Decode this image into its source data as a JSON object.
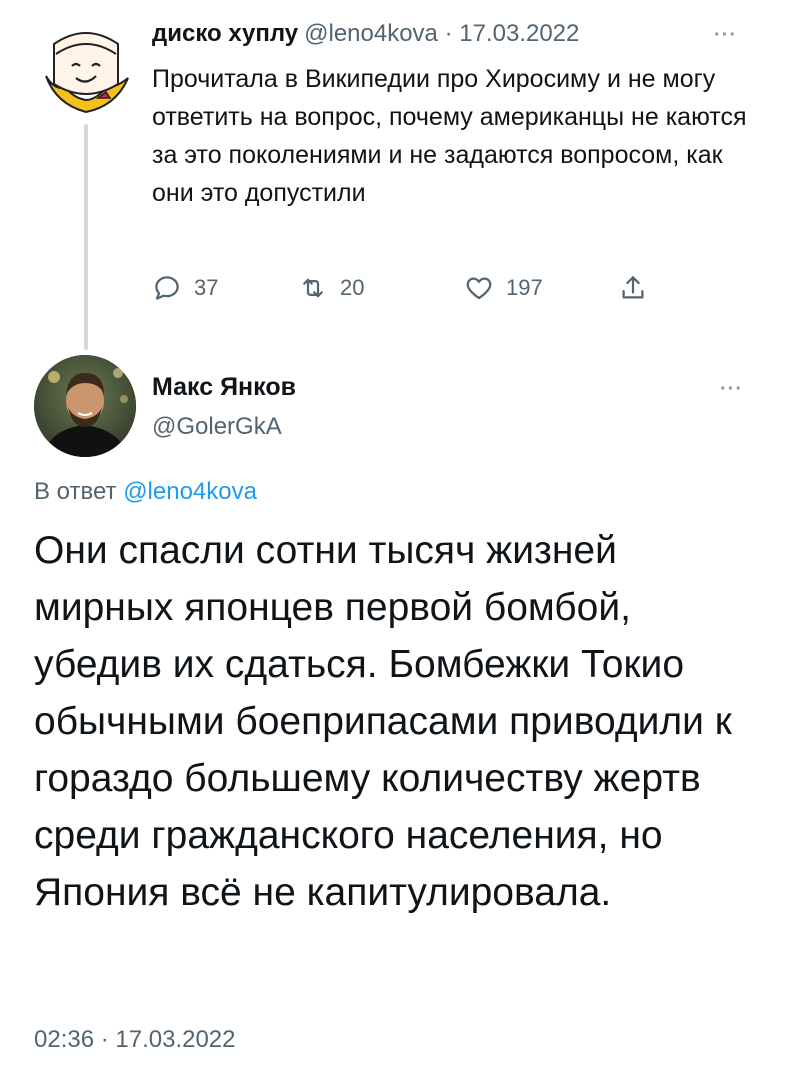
{
  "parent_tweet": {
    "display_name": "диско хуплу",
    "handle": "@leno4kova",
    "date": "17.03.2022",
    "meta_separator": "·",
    "more_label": "···",
    "text": "Прочитала в Википедии про Хиросиму и не могу ответить на вопрос, почему американцы не каются за это поколениями и не задаются вопросом, как они это допустили",
    "metrics": {
      "replies": "37",
      "retweets": "20",
      "likes": "197"
    },
    "icons": {
      "reply": "reply-icon",
      "retweet": "retweet-icon",
      "like": "heart-icon",
      "share": "share-icon"
    }
  },
  "reply_tweet": {
    "display_name": "Макс Янков",
    "handle": "@GolerGkA",
    "more_label": "···",
    "reply_prefix": "В ответ",
    "reply_mention": "@leno4kova",
    "text": "Они спасли сотни тысяч жизней мирных японцев первой бомбой, убедив их сдаться. Бомбежки Токио обычными боеприпасами приводили к гораздо большему количеству жертв среди гражданского населения, но Япония всё не капитулировала.",
    "timestamp": "02:36 · 17.03.2022"
  },
  "colors": {
    "text_primary": "#0f1419",
    "text_secondary": "#536471",
    "link": "#1d9bf0",
    "thread_line": "#cfd9de",
    "avatar_accent": "#e8b800"
  }
}
